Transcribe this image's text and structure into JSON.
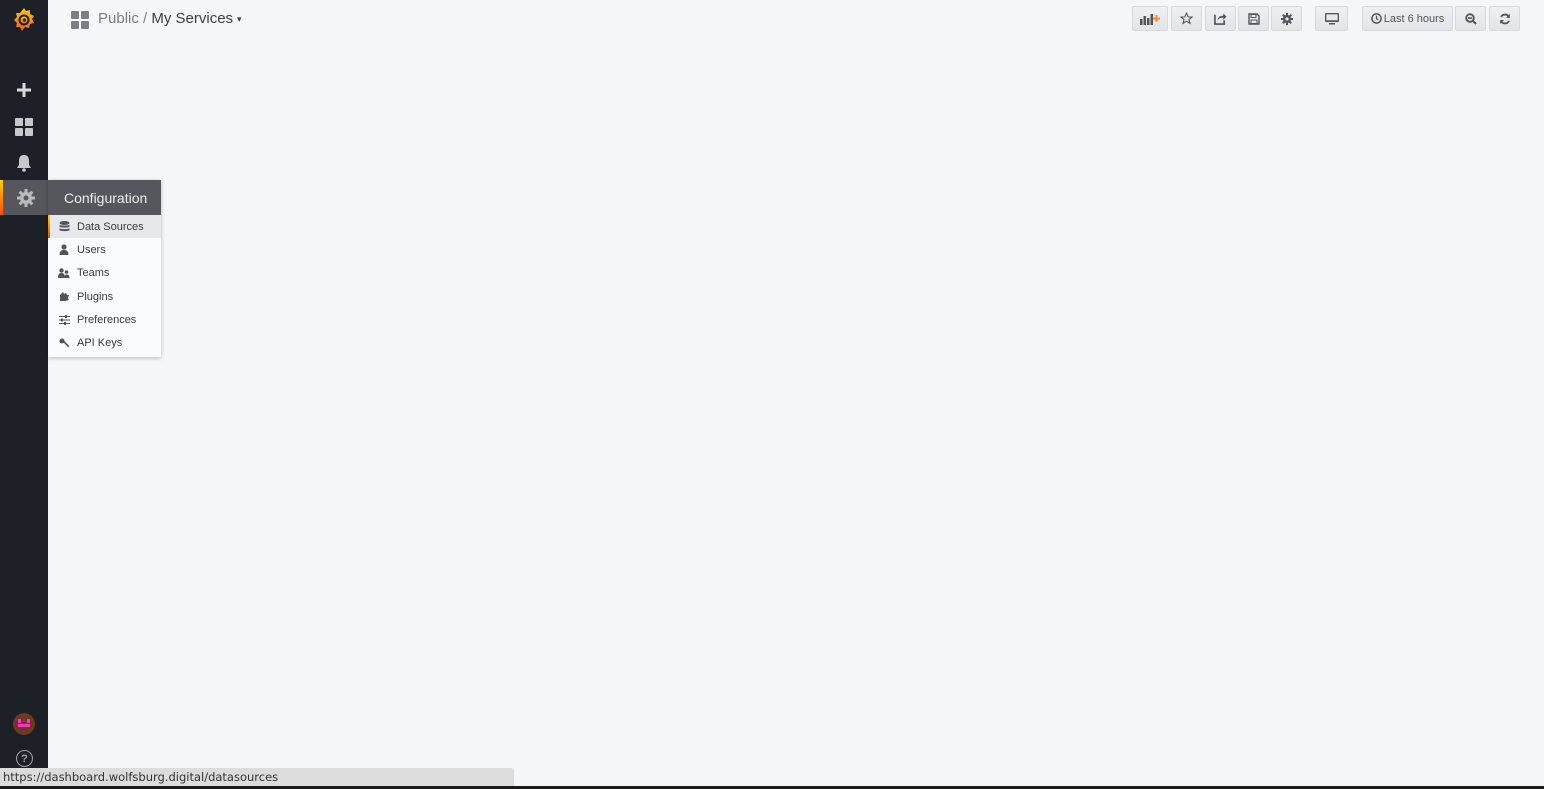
{
  "navbar": {
    "breadcrumb_folder": "Public / ",
    "breadcrumb_title": "My Services",
    "caret": "▾",
    "buttons": {
      "add_panel": "add-panel-icon",
      "star": "star-icon",
      "share": "share-icon",
      "save": "save-icon",
      "settings": "gear-icon",
      "tv_mode": "monitor-icon",
      "time_range": "Last 6 hours",
      "zoom_out": "zoom-out-icon",
      "refresh": "refresh-icon"
    }
  },
  "sidemenu": {
    "items": [
      {
        "name": "create",
        "icon": "plus-icon"
      },
      {
        "name": "dashboards",
        "icon": "grid-icon"
      },
      {
        "name": "alerting",
        "icon": "bell-icon"
      },
      {
        "name": "configuration",
        "icon": "gear-icon"
      }
    ],
    "help_label": "?"
  },
  "config_menu": {
    "header": "Configuration",
    "items": [
      {
        "label": "Data Sources",
        "icon": "database-icon",
        "active": true
      },
      {
        "label": "Users",
        "icon": "user-icon"
      },
      {
        "label": "Teams",
        "icon": "users-icon"
      },
      {
        "label": "Plugins",
        "icon": "plug-icon"
      },
      {
        "label": "Preferences",
        "icon": "sliders-icon"
      },
      {
        "label": "API Keys",
        "icon": "key-icon"
      }
    ]
  },
  "status_bar": {
    "url": "https://dashboard.wolfsburg.digital/datasources"
  },
  "colors": {
    "accent_start": "#ffd500",
    "accent_end": "#ff4400",
    "sidebar_bg": "#1e2028"
  }
}
